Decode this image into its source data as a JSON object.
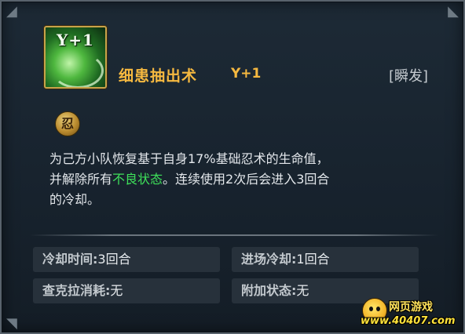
{
  "skill": {
    "icon_name": "healing-swirl-icon",
    "icon_text": "Y+1",
    "name": "细患抽出术",
    "level": "Y+1",
    "cast_type": "[瞬发]",
    "badge_icon": "ninjutsu-badge-icon",
    "badge_text": "忍"
  },
  "description": {
    "part1": "为己方小队恢复基于自身17%基础忍术的生命值，",
    "part2": "并解除所有",
    "highlight": "不良状态",
    "part3": "。连续使用2次后会进入3回合",
    "part4": "的冷却。"
  },
  "stats": {
    "cooldown_label": "冷却时间:",
    "cooldown_value": "3回合",
    "entry_cooldown_label": "进场冷却:",
    "entry_cooldown_value": "1回合",
    "chakra_cost_label": "查克拉消耗:",
    "chakra_cost_value": "无",
    "extra_status_label": "附加状态:",
    "extra_status_value": "无"
  },
  "watermark": {
    "title": "网页游戏",
    "url": "www.40407.com"
  },
  "colors": {
    "skill_name": "#f6b940",
    "highlight": "#3ee05a",
    "text": "#e4e8ec"
  }
}
